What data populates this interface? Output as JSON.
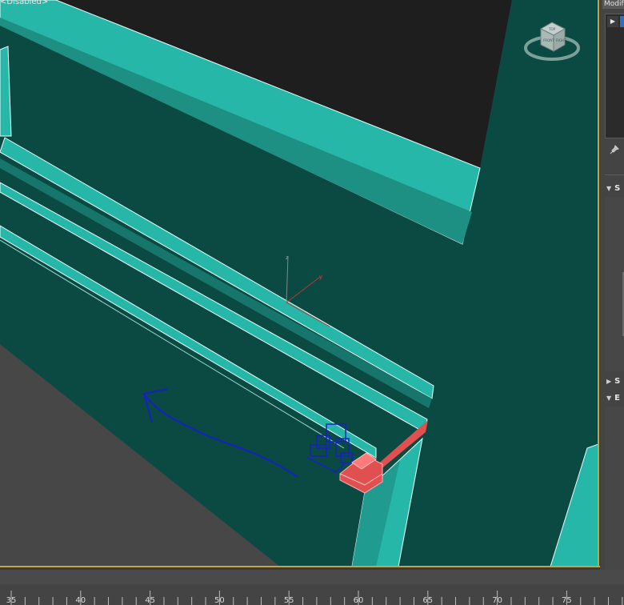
{
  "viewport": {
    "label": "<Disabled>",
    "viewcube_top_face": "TOP",
    "viewcube_front_face": "FRONT",
    "viewcube_right_face": "RIGHT"
  },
  "command_panel": {
    "tab_label": "Modify",
    "play_glyph": "▶",
    "pin_glyph": "📌",
    "rollouts": [
      {
        "label": "S",
        "arrow": "▼"
      },
      {
        "label": "S",
        "arrow": "▶"
      },
      {
        "label": "E",
        "arrow": "▼"
      }
    ]
  },
  "track_bar": {
    "tick_labels": [
      "35",
      "40",
      "45",
      "50",
      "55",
      "60",
      "65",
      "70",
      "75"
    ]
  },
  "colors": {
    "wall": "#0b4a42",
    "edge": "#27b7a8",
    "selection": "#e05050",
    "stroke": "#1420c8",
    "viewport_border": "#c8a24a"
  }
}
